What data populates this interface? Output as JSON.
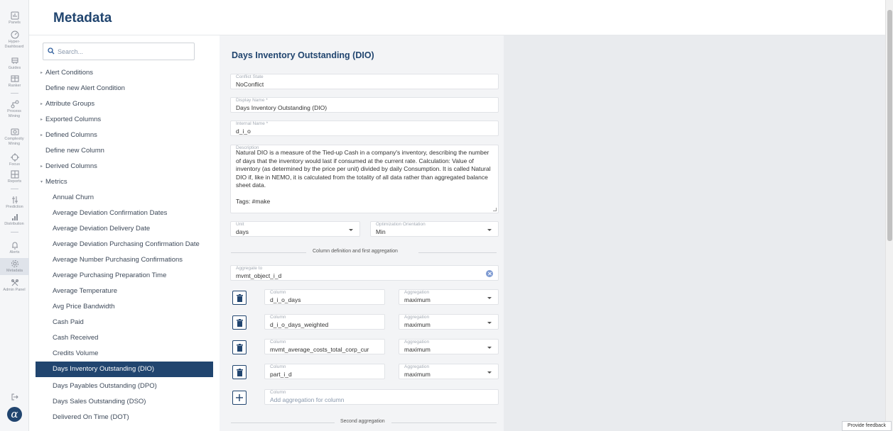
{
  "header": {
    "title": "Metadata"
  },
  "rail": {
    "items": [
      {
        "label": "Panels"
      },
      {
        "label": "Hyper-Dashboard"
      },
      {
        "label": "Guides"
      },
      {
        "label": "Ranker"
      },
      {
        "label": "Process Mining"
      },
      {
        "label": "Complexity Mining"
      },
      {
        "label": "Focus"
      },
      {
        "label": "Reports"
      },
      {
        "label": "Prediction"
      },
      {
        "label": "Distribution"
      },
      {
        "label": "Alerts"
      },
      {
        "label": "Metadata"
      },
      {
        "label": "Admin Panel"
      }
    ],
    "logo": "α"
  },
  "search": {
    "placeholder": "Search..."
  },
  "nav": {
    "items": [
      {
        "label": "Alert Conditions"
      },
      {
        "label": "Define new Alert Condition"
      },
      {
        "label": "Attribute Groups"
      },
      {
        "label": "Exported Columns"
      },
      {
        "label": "Defined Columns"
      },
      {
        "label": "Define new Column"
      },
      {
        "label": "Derived Columns"
      },
      {
        "label": "Metrics"
      },
      {
        "label": "Annual Churn"
      },
      {
        "label": "Average Deviation Confirmation Dates"
      },
      {
        "label": "Average Deviation Delivery Date"
      },
      {
        "label": "Average Deviation Purchasing Confirmation Date"
      },
      {
        "label": "Average Number Purchasing Confirmations"
      },
      {
        "label": "Average Purchasing Preparation Time"
      },
      {
        "label": "Average Temperature"
      },
      {
        "label": "Avg Price Bandwidth"
      },
      {
        "label": "Cash Paid"
      },
      {
        "label": "Cash Received"
      },
      {
        "label": "Credits Volume"
      },
      {
        "label": "Days Inventory Outstanding (DIO)"
      },
      {
        "label": "Days Payables Outstanding (DPO)"
      },
      {
        "label": "Days Sales Outstanding (DSO)"
      },
      {
        "label": "Delivered On Time (DOT)"
      }
    ]
  },
  "form": {
    "title": "Days Inventory Outstanding (DIO)",
    "conflict_state": {
      "label": "Conflict State",
      "value": "NoConflict"
    },
    "display_name": {
      "label": "Display Name *",
      "value": "Days Inventory Outstanding (DIO)"
    },
    "internal_name": {
      "label": "Internal Name *",
      "value": "d_i_o"
    },
    "description": {
      "label": "Description",
      "value": "Natural DIO is a measure of the Tied-up Cash in a company's inventory, describing the number of days that the inventory would last if consumed at the current rate. Calculation: Value of inventory (as determined by the price per unit) divided by daily Consumption. It is called Natural DIO if, like in NEMO, it is calculated from the totality of all data rather than aggregated balance sheet data.\n\nTags: #make"
    },
    "unit": {
      "label": "Unit",
      "value": "days"
    },
    "optimization": {
      "label": "Optimization Orientation",
      "value": "Min"
    },
    "section1": "Column definition and first aggregation",
    "aggregate_to": {
      "label": "Aggregate to",
      "value": "mvmt_object_i_d"
    },
    "columns": [
      {
        "column_label": "Column",
        "column": "d_i_o_days",
        "agg_label": "Aggregation",
        "agg": "maximum"
      },
      {
        "column_label": "Column",
        "column": "d_i_o_days_weighted",
        "agg_label": "Aggregation",
        "agg": "maximum"
      },
      {
        "column_label": "Column",
        "column": "mvmt_average_costs_total_corp_cur",
        "agg_label": "Aggregation",
        "agg": "maximum"
      },
      {
        "column_label": "Column",
        "column": "part_i_d",
        "agg_label": "Aggregation",
        "agg": "maximum"
      }
    ],
    "add_column": {
      "label": "Column",
      "placeholder": "Add aggregation for column"
    },
    "section2": "Second aggregation"
  },
  "feedback": "Provide feedback",
  "colors": {
    "brand": "#21456f",
    "selected_bg": "#21456f",
    "panel_bg": "#f3f4f6",
    "canvas_bg": "#e9ebee"
  }
}
